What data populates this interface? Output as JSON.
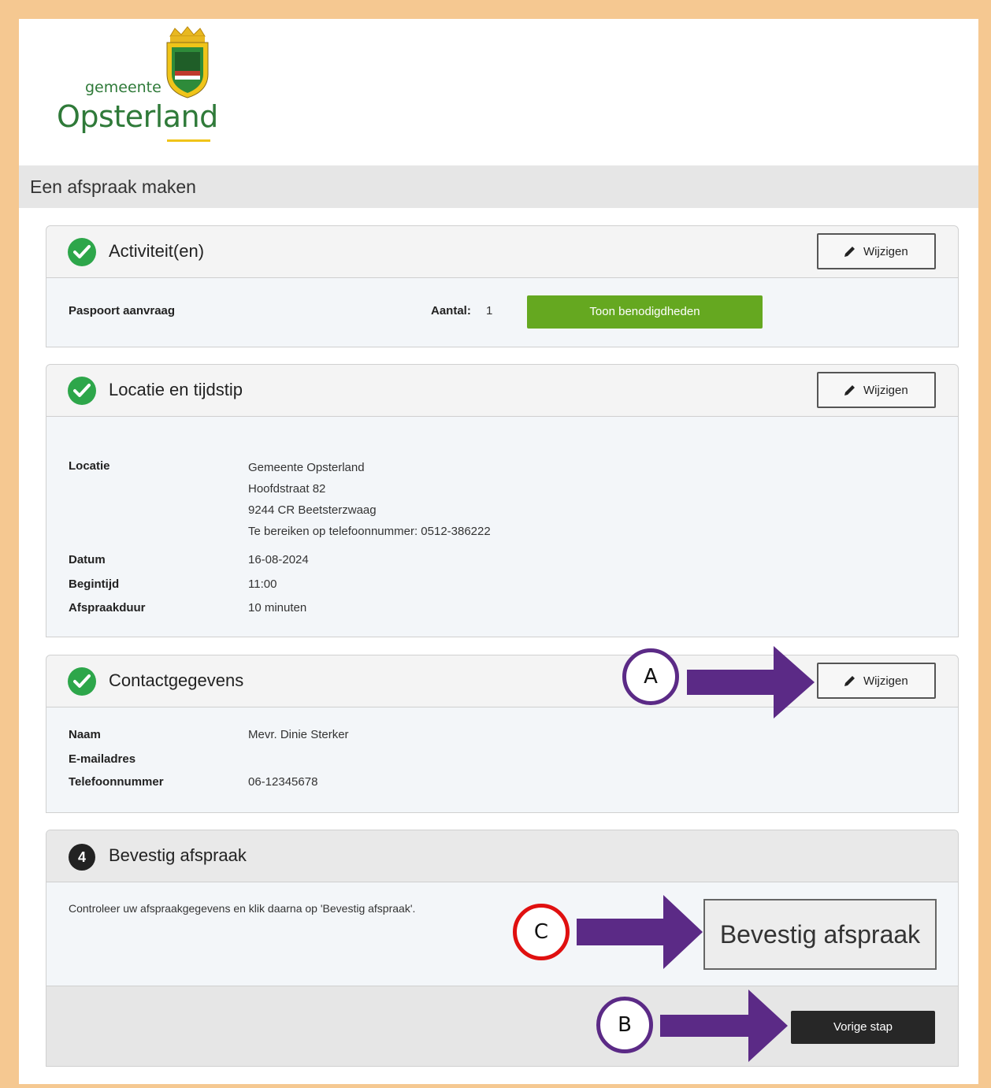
{
  "logo": {
    "small_text": "gemeente",
    "big_text": "Opsterland",
    "accent": "#2f7a39"
  },
  "page_title": "Een afspraak maken",
  "sections": {
    "activities": {
      "title": "Activiteit(en)",
      "edit_label": "Wijzigen",
      "item_name": "Paspoort aanvraag",
      "amount_label": "Aantal:",
      "amount_value": "1",
      "requirements_button": "Toon benodigdheden"
    },
    "location": {
      "title": "Locatie en tijdstip",
      "edit_label": "Wijzigen",
      "location_label": "Locatie",
      "location_lines": [
        "Gemeente Opsterland",
        "Hoofdstraat 82",
        "9244 CR Beetsterzwaag",
        "Te bereiken op telefoonnummer: 0512-386222"
      ],
      "date_label": "Datum",
      "date_value": "16-08-2024",
      "start_label": "Begintijd",
      "start_value": "11:00",
      "duration_label": "Afspraakduur",
      "duration_value": "10 minuten"
    },
    "contact": {
      "title": "Contactgegevens",
      "edit_label": "Wijzigen",
      "name_label": "Naam",
      "name_value": "Mevr. Dinie Sterker",
      "email_label": "E-mailadres",
      "phone_label": "Telefoonnummer",
      "phone_value": "06-12345678"
    },
    "confirm": {
      "step_number": "4",
      "title": "Bevestig afspraak",
      "instruction": "Controleer uw afspraakgegevens en klik daarna op 'Bevestig afspraak'.",
      "confirm_button": "Bevestig afspraak",
      "previous_button": "Vorige stap"
    }
  },
  "annotations": {
    "a": "A",
    "b": "B",
    "c": "C",
    "arrow_color": "#5b2a86",
    "c_border_color": "#e01010"
  }
}
